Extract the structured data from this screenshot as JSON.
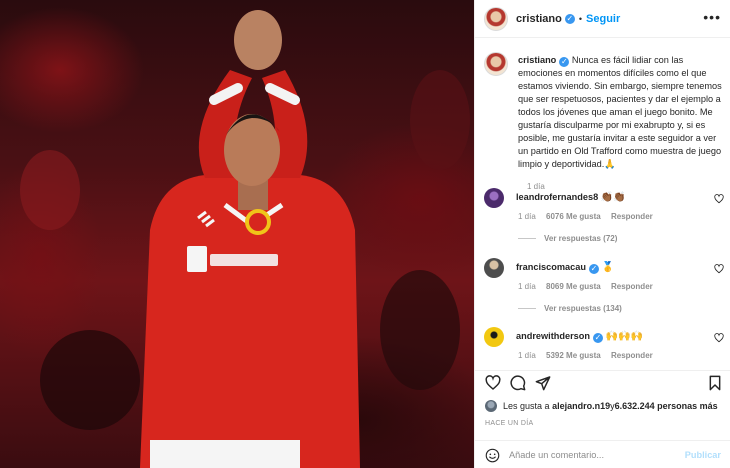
{
  "post": {
    "author": "cristiano",
    "follow_label": "Seguir",
    "separator": "•",
    "more_label": "•••"
  },
  "caption": {
    "author": "cristiano",
    "text": "Nunca es fácil lidiar con las emociones en momentos difíciles como el que estamos viviendo. Sin embargo, siempre tenemos que ser respetuosos, pacientes y dar el ejemplo a todos los jóvenes que aman el juego bonito. Me gustaría disculparme por mi exabrupto y, si es posible, me gustaría invitar a este seguidor a ver un partido en Old Trafford como muestra de juego limpio y deportividad.🙏",
    "time": "1 día"
  },
  "comments": [
    {
      "user": "leandrofernandes8",
      "text": "👏🏾👏🏾",
      "time": "1 día",
      "likes": "6076 Me gusta",
      "reply_label": "Responder",
      "view_replies": "Ver respuestas (72)",
      "avatar_color": "#4b2a6b"
    },
    {
      "user": "franciscomacau",
      "text": "🥇",
      "time": "1 día",
      "likes": "8069 Me gusta",
      "reply_label": "Responder",
      "view_replies": "Ver respuestas (134)",
      "avatar_color": "#6b6b6b"
    },
    {
      "user": "andrewithderson",
      "text": "🙌🙌🙌",
      "time": "1 día",
      "likes": "5392 Me gusta",
      "reply_label": "Responder",
      "avatar_color": "#f2c811"
    }
  ],
  "likes": {
    "prefix": "Les gusta a",
    "user": "alejandro.n19",
    "connector": "y",
    "count": "6.632.244 personas más"
  },
  "timestamp": "HACE UN DÍA",
  "add_comment": {
    "placeholder": "Añade un comentario...",
    "publish_label": "Publicar"
  },
  "colors": {
    "accent": "#0095f6",
    "verified": "#3897f0",
    "jersey": "#d7261e"
  },
  "icons": [
    "more-options-icon",
    "verified-icon",
    "heart-icon",
    "comment-icon",
    "share-icon",
    "bookmark-icon",
    "emoji-icon"
  ]
}
